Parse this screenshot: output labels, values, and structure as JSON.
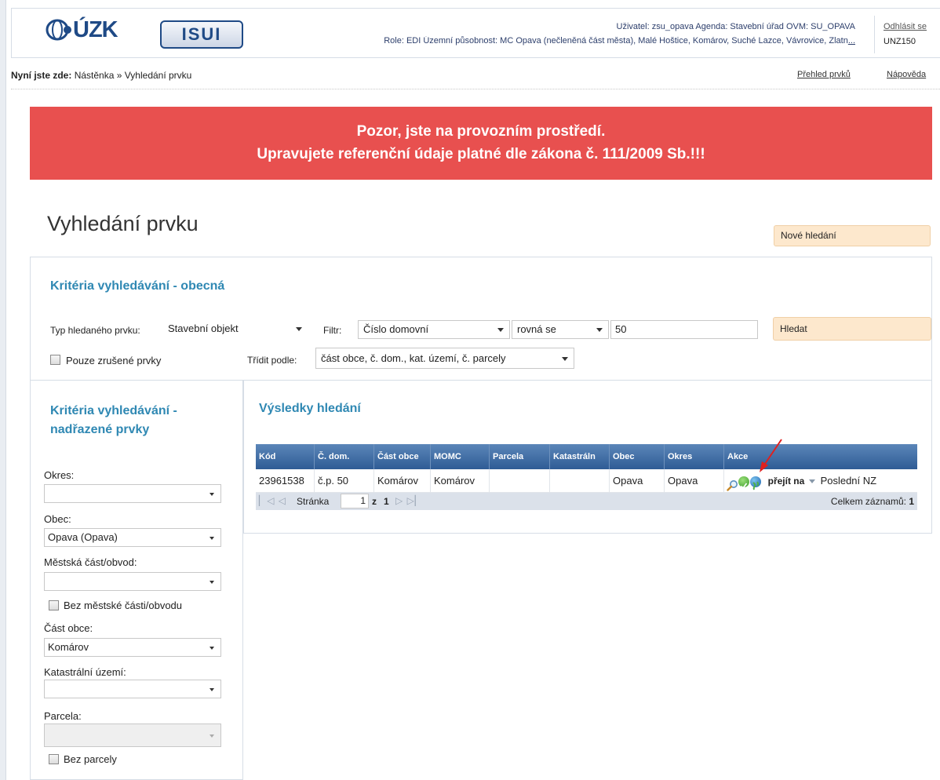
{
  "header": {
    "logo_cuzk": "ÚZK",
    "logo_isui": "ISUI",
    "user_line": "Uživatel: zsu_opava   Agenda: Stavební úřad   OVM: SU_OPAVA",
    "role_line_text": "Role: EDI   Územní působnost: MC Opava (nečleněná část města), Malé Hoštice, Komárov, Suché Lazce, Vávrovice, Zlatn",
    "role_line_more": "...",
    "logout": "Odhlásit se",
    "station": "UNZ150"
  },
  "breadcrumb": {
    "label": "Nyní jste zde:",
    "path": "Nástěnka » Vyhledání prvku"
  },
  "top_links": {
    "prehled": "Přehled prvků",
    "napoveda": "Nápověda"
  },
  "banner": {
    "line1": "Pozor, jste na provozním prostředí.",
    "line2": "Upravujete referenční údaje platné dle zákona č. 111/2009 Sb.!!!",
    "color": "#e8504f"
  },
  "page": {
    "title": "Vyhledání prvku",
    "new_search": "Nové hledání"
  },
  "general": {
    "title": "Kritéria vyhledávání - obecná",
    "type_label": "Typ hledaného prvku:",
    "type_value": "Stavební objekt",
    "filter_label": "Filtr:",
    "filter_value": "Číslo domovní",
    "operator_value": "rovná se",
    "search_value": "50",
    "search_button": "Hledat",
    "only_cancelled": "Pouze zrušené prvky",
    "sort_label": "Třídit podle:",
    "sort_value": "část obce, č. dom., kat. území, č. parcely"
  },
  "parent": {
    "title": "Kritéria vyhledávání - nadřazené prvky",
    "okres_label": "Okres:",
    "okres_value": "",
    "obec_label": "Obec:",
    "obec_value": "Opava (Opava)",
    "mestska_label": "Městská část/obvod:",
    "mestska_value": "",
    "bez_mestske": "Bez městské části/obvodu",
    "cast_label": "Část obce:",
    "cast_value": "Komárov",
    "katastr_label": "Katastrální území:",
    "katastr_value": "",
    "parcela_label": "Parcela:",
    "parcela_value": "",
    "bez_parcely": "Bez parcely"
  },
  "results": {
    "title": "Výsledky hledání",
    "columns": [
      "Kód",
      "Č. dom.",
      "Část obce",
      "MOMC",
      "Parcela",
      "Katastráln",
      "Obec",
      "Okres",
      "Akce"
    ],
    "row": {
      "kod": "23961538",
      "cdom": "č.p. 50",
      "cast": "Komárov",
      "momc": "Komárov",
      "parcela": "",
      "katastr": "",
      "obec": "Opava",
      "okres": "Opava",
      "action_goto": "přejít na",
      "action_last": "Poslední NZ"
    },
    "pager": {
      "page_label": "Stránka",
      "page_value": "1",
      "of": "z",
      "total_pages": "1",
      "count_label": "Celkem záznamů:",
      "count_value": "1"
    },
    "header_color": "#3d6aa3"
  },
  "icons": [
    "cuzk-logo-icon",
    "magnifier-icon",
    "check-icon",
    "globe-icon",
    "dropdown-arrow-icon",
    "red-pointer-arrow"
  ]
}
